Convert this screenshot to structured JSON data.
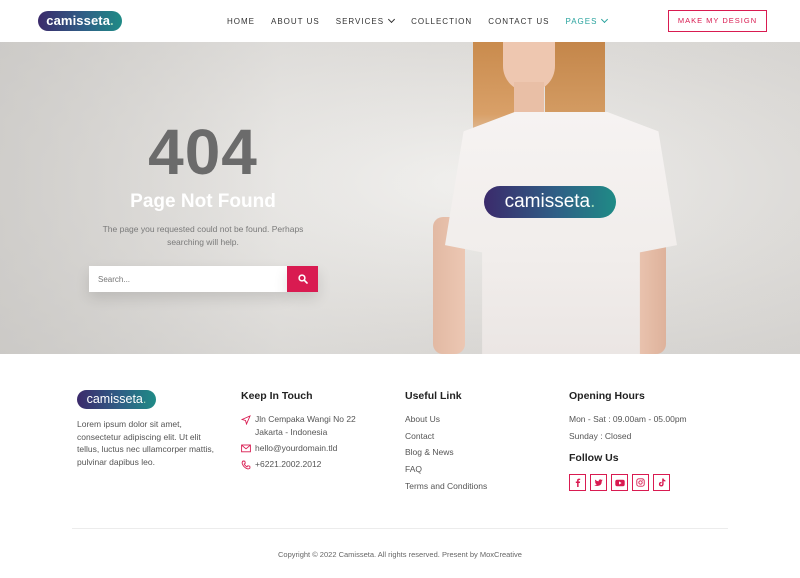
{
  "header": {
    "logo_text": "camisseta",
    "logo_dot": ".",
    "nav": [
      {
        "label": "HOME"
      },
      {
        "label": "ABOUT US"
      },
      {
        "label": "SERVICES"
      },
      {
        "label": "COLLECTION"
      },
      {
        "label": "CONTACT US"
      },
      {
        "label": "PAGES"
      }
    ],
    "cta_label": "MAKE MY DESIGN"
  },
  "hero": {
    "code": "404",
    "title": "Page Not Found",
    "description": "The page you requested could not be found. Perhaps searching will help.",
    "search_placeholder": "Search...",
    "shirt_logo_text": "camisseta",
    "shirt_logo_dot": "."
  },
  "footer": {
    "logo_text": "camisseta",
    "logo_dot": ".",
    "about": "Lorem ipsum dolor sit amet, consectetur adipiscing elit. Ut elit tellus, luctus nec ullamcorper mattis, pulvinar dapibus leo.",
    "keep_in_touch": {
      "heading": "Keep In Touch",
      "address": "Jln Cempaka Wangi No 22 Jakarta - Indonesia",
      "email": "hello@yourdomain.tld",
      "phone": "+6221.2002.2012"
    },
    "useful_link": {
      "heading": "Useful Link",
      "links": [
        "About Us",
        "Contact",
        "Blog & News",
        "FAQ",
        "Terms and Conditions"
      ]
    },
    "opening_hours": {
      "heading": "Opening Hours",
      "weekdays": "Mon - Sat : 09.00am - 05.00pm",
      "sunday": "Sunday : Closed"
    },
    "follow_us": {
      "heading": "Follow Us",
      "icons": [
        "facebook-icon",
        "twitter-icon",
        "youtube-icon",
        "instagram-icon",
        "tiktok-icon"
      ]
    },
    "copyright": "Copyright © 2022 Camisseta. All rights reserved. Present by MoxCreative"
  },
  "colors": {
    "accent": "#d91b51",
    "active_nav": "#2aa39e",
    "logo_gradient_start": "#3b2a6b",
    "logo_gradient_end": "#1f8b86"
  }
}
